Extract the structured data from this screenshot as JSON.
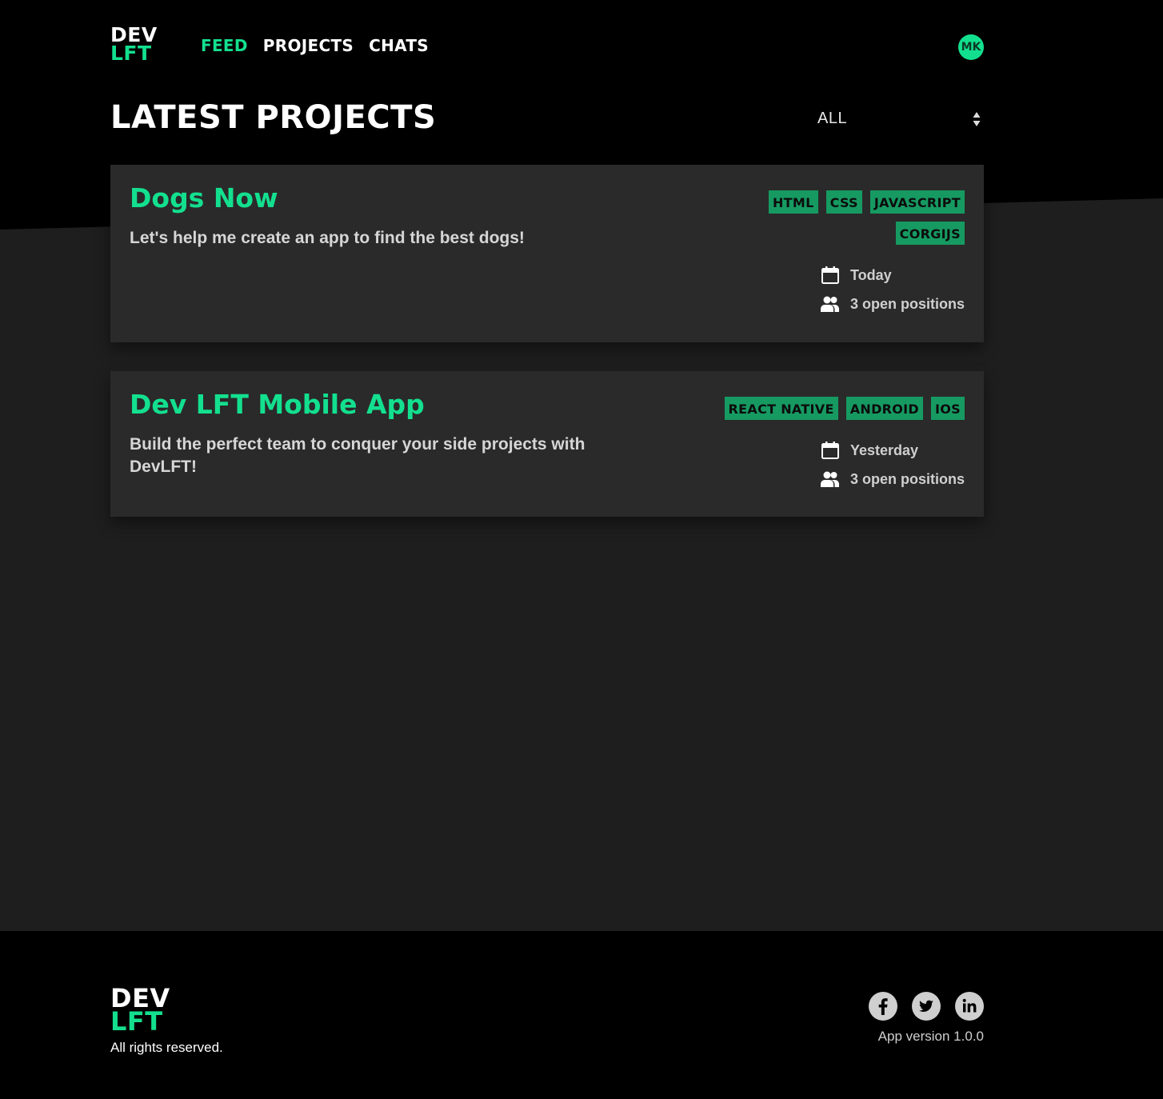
{
  "brand": {
    "line1": "DEV",
    "line2": "LFT",
    "accent_color": "#13e08f"
  },
  "nav": {
    "items": [
      {
        "label": "FEED",
        "active": true
      },
      {
        "label": "PROJECTS",
        "active": false
      },
      {
        "label": "CHATS",
        "active": false
      }
    ]
  },
  "user": {
    "initials": "MK"
  },
  "main": {
    "title": "LATEST PROJECTS",
    "filter": {
      "selected": "ALL"
    }
  },
  "projects": [
    {
      "title": "Dogs Now",
      "description": "Let's help me create an app to find the best dogs!",
      "tags": [
        "HTML",
        "CSS",
        "JAVASCRIPT",
        "CORGIJS"
      ],
      "date": "Today",
      "positions": "3 open positions"
    },
    {
      "title": "Dev LFT Mobile App",
      "description": "Build the perfect team to conquer your side projects with DevLFT!",
      "tags": [
        "REACT NATIVE",
        "ANDROID",
        "IOS"
      ],
      "date": "Yesterday",
      "positions": "3 open positions"
    }
  ],
  "footer": {
    "rights": "All rights reserved.",
    "version": "App version 1.0.0",
    "socials": [
      "facebook-icon",
      "twitter-icon",
      "linkedin-icon"
    ]
  }
}
